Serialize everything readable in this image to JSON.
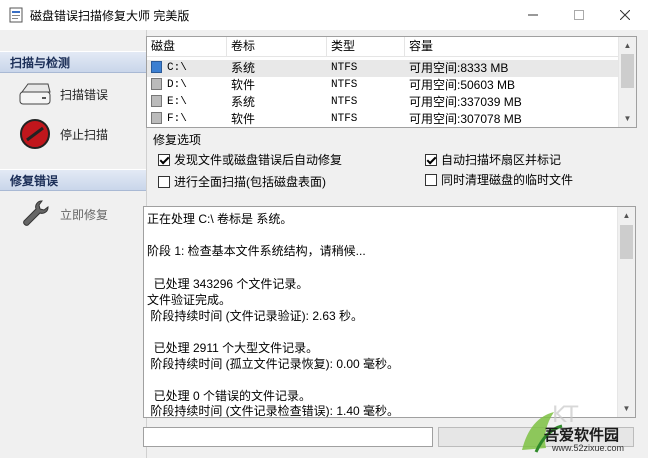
{
  "window": {
    "title": "磁盘错误扫描修复大师 完美版",
    "min_icon": "minimize-icon",
    "max_icon": "maximize-icon",
    "close_icon": "close-icon"
  },
  "sidebar": {
    "scan_section": "扫描与检测",
    "scan_button": "扫描错误",
    "stop_button": "停止扫描",
    "repair_section": "修复错误",
    "repair_button": "立即修复"
  },
  "drives": {
    "columns": [
      "磁盘",
      "卷标",
      "类型",
      "容量"
    ],
    "rows": [
      {
        "disk": "C:\\",
        "label": "系统",
        "type": "NTFS",
        "capacity": "可用空间:8333 MB",
        "selected": true
      },
      {
        "disk": "D:\\",
        "label": "软件",
        "type": "NTFS",
        "capacity": "可用空间:50603 MB",
        "selected": false
      },
      {
        "disk": "E:\\",
        "label": "系统",
        "type": "NTFS",
        "capacity": "可用空间:337039 MB",
        "selected": false
      },
      {
        "disk": "F:\\",
        "label": "软件",
        "type": "NTFS",
        "capacity": "可用空间:307078 MB",
        "selected": false
      }
    ]
  },
  "repair_options": {
    "label": "修复选项",
    "auto_fix": {
      "text": "发现文件或磁盘错误后自动修复",
      "checked": true
    },
    "full_scan": {
      "text": "进行全面扫描(包括磁盘表面)",
      "checked": false
    },
    "bad_sector": {
      "text": "自动扫描坏扇区并标记",
      "checked": true
    },
    "clean_temp": {
      "text": "同时清理磁盘的临时文件",
      "checked": false
    }
  },
  "log": {
    "lines": [
      "正在处理 C:\\ 卷标是 系统。",
      "阶段 1: 检查基本文件系统结构，请稍候...",
      "  已处理 343296 个文件记录。",
      "文件验证完成。",
      " 阶段持续时间 (文件记录验证): 2.63 秒。",
      "  已处理 2911 个大型文件记录。",
      " 阶段持续时间 (孤立文件记录恢复): 0.00 毫秒。",
      "  已处理 0 个错误的文件记录。",
      " 阶段持续时间 (文件记录检查错误): 1.40 毫秒。"
    ]
  },
  "status": {
    "text": "",
    "progress": 0
  },
  "watermark": {
    "name": "吾爱软件园",
    "url": "www.52zixue.com"
  }
}
